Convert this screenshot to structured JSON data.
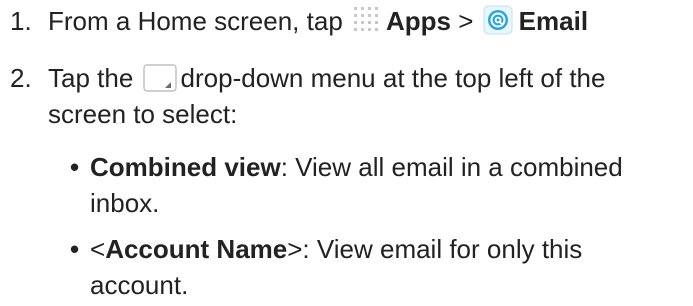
{
  "steps": [
    {
      "number": "1.",
      "text_before_apps": "From a Home screen, tap",
      "apps_label": "Apps",
      "separator": ">",
      "email_label": "Email",
      "apps_icon": "apps-grid-icon",
      "email_icon": "email-app-icon"
    },
    {
      "number": "2.",
      "text_before_icon": "Tap the",
      "line1_after_icon": "drop-down menu at the top left of the",
      "line2": "screen to select:",
      "dropdown_icon": "dropdown-menu-icon"
    }
  ],
  "bullets": [
    {
      "bold": "Combined view",
      "line1_rest": ": View all email in a combined",
      "line2": "inbox."
    },
    {
      "bold_prefix": "<",
      "bold": "Account Name",
      "bold_suffix": ">",
      "line1_rest": ": View email for only this",
      "line2": "account."
    }
  ],
  "colors": {
    "text": "#222222",
    "apps_icon_dots": "#c8c8c8",
    "email_icon_primary": "#2aa6dc",
    "email_icon_bg": "#e9f6fb",
    "dropdown_border": "#b5b5b5"
  }
}
